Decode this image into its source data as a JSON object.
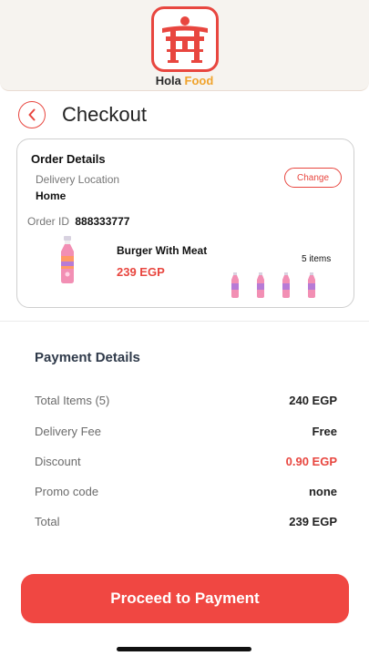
{
  "header": {
    "brand_part1": "Hola",
    "brand_part2": "Food",
    "logo_icon": "torii-gate-icon",
    "colors": {
      "accent": "#e8463f",
      "brand_secondary": "#f0a32c"
    }
  },
  "page": {
    "title": "Checkout",
    "back_icon": "chevron-left-icon"
  },
  "order_details": {
    "title": "Order Details",
    "delivery_location_label": "Delivery Location",
    "delivery_location_value": "Home",
    "change_label": "Change",
    "order_id_label": "Order ID",
    "order_id_value": "888333777",
    "product": {
      "name": "Burger With Meat",
      "price": "239 EGP",
      "items_count": "5 items",
      "thumbnail_icon": "drink-bottle-icon"
    }
  },
  "payment": {
    "title": "Payment Details",
    "rows": [
      {
        "label": "Total Items (5)",
        "value": "240 EGP"
      },
      {
        "label": "Delivery Fee",
        "value": "Free"
      },
      {
        "label": "Discount",
        "value": "0.90 EGP"
      },
      {
        "label": "Promo code",
        "value": "none"
      },
      {
        "label": "Total",
        "value": "239 EGP"
      }
    ]
  },
  "cta": {
    "label": "Proceed to Payment"
  }
}
